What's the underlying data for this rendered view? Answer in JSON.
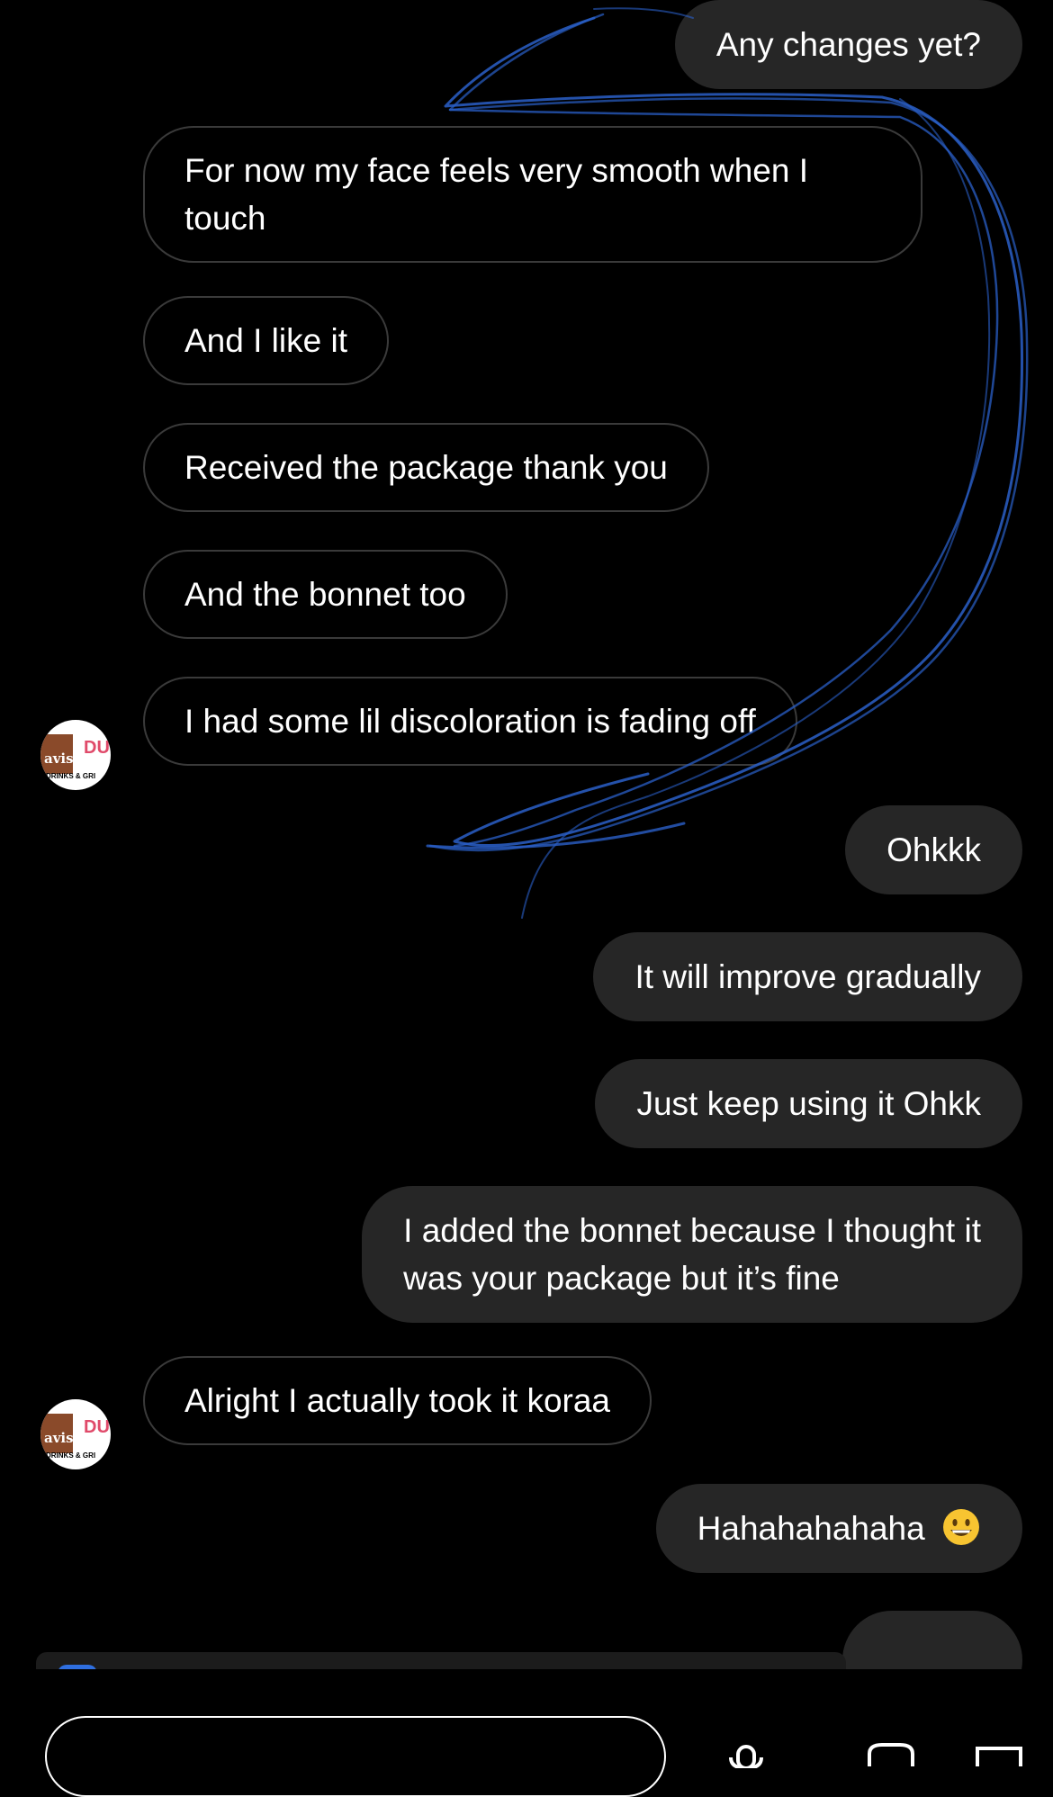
{
  "conversation": {
    "messages": [
      {
        "direction": "out",
        "text": "Any changes yet?"
      },
      {
        "direction": "in",
        "text_lines": [
          "For now my face feels very smooth when I",
          "touch"
        ]
      },
      {
        "direction": "in",
        "text": "And I like it"
      },
      {
        "direction": "in",
        "text": "Received the package thank you"
      },
      {
        "direction": "in",
        "text": "And the bonnet too"
      },
      {
        "direction": "in",
        "text": "I had some lil discoloration is fading off"
      },
      {
        "direction": "out",
        "text": "Ohkkk"
      },
      {
        "direction": "out",
        "text": "It will improve gradually"
      },
      {
        "direction": "out",
        "text": "Just keep using it Ohkk"
      },
      {
        "direction": "out",
        "text_lines": [
          "I added the bonnet because I thought it",
          "was your package but it’s fine"
        ]
      },
      {
        "direction": "in",
        "text": "Alright I actually took it koraa"
      },
      {
        "direction": "out",
        "text": "Hahahahahaha",
        "emoji": "grinning-face-emoji"
      }
    ]
  },
  "avatar": {
    "logo_text": "avish",
    "logo_du": "DU",
    "logo_sub": "DRINKS & GRI"
  },
  "colors": {
    "background": "#000000",
    "outgoing_bubble": "#262626",
    "incoming_border": "#3a3a3a",
    "scribble": "#2a5fc8"
  }
}
